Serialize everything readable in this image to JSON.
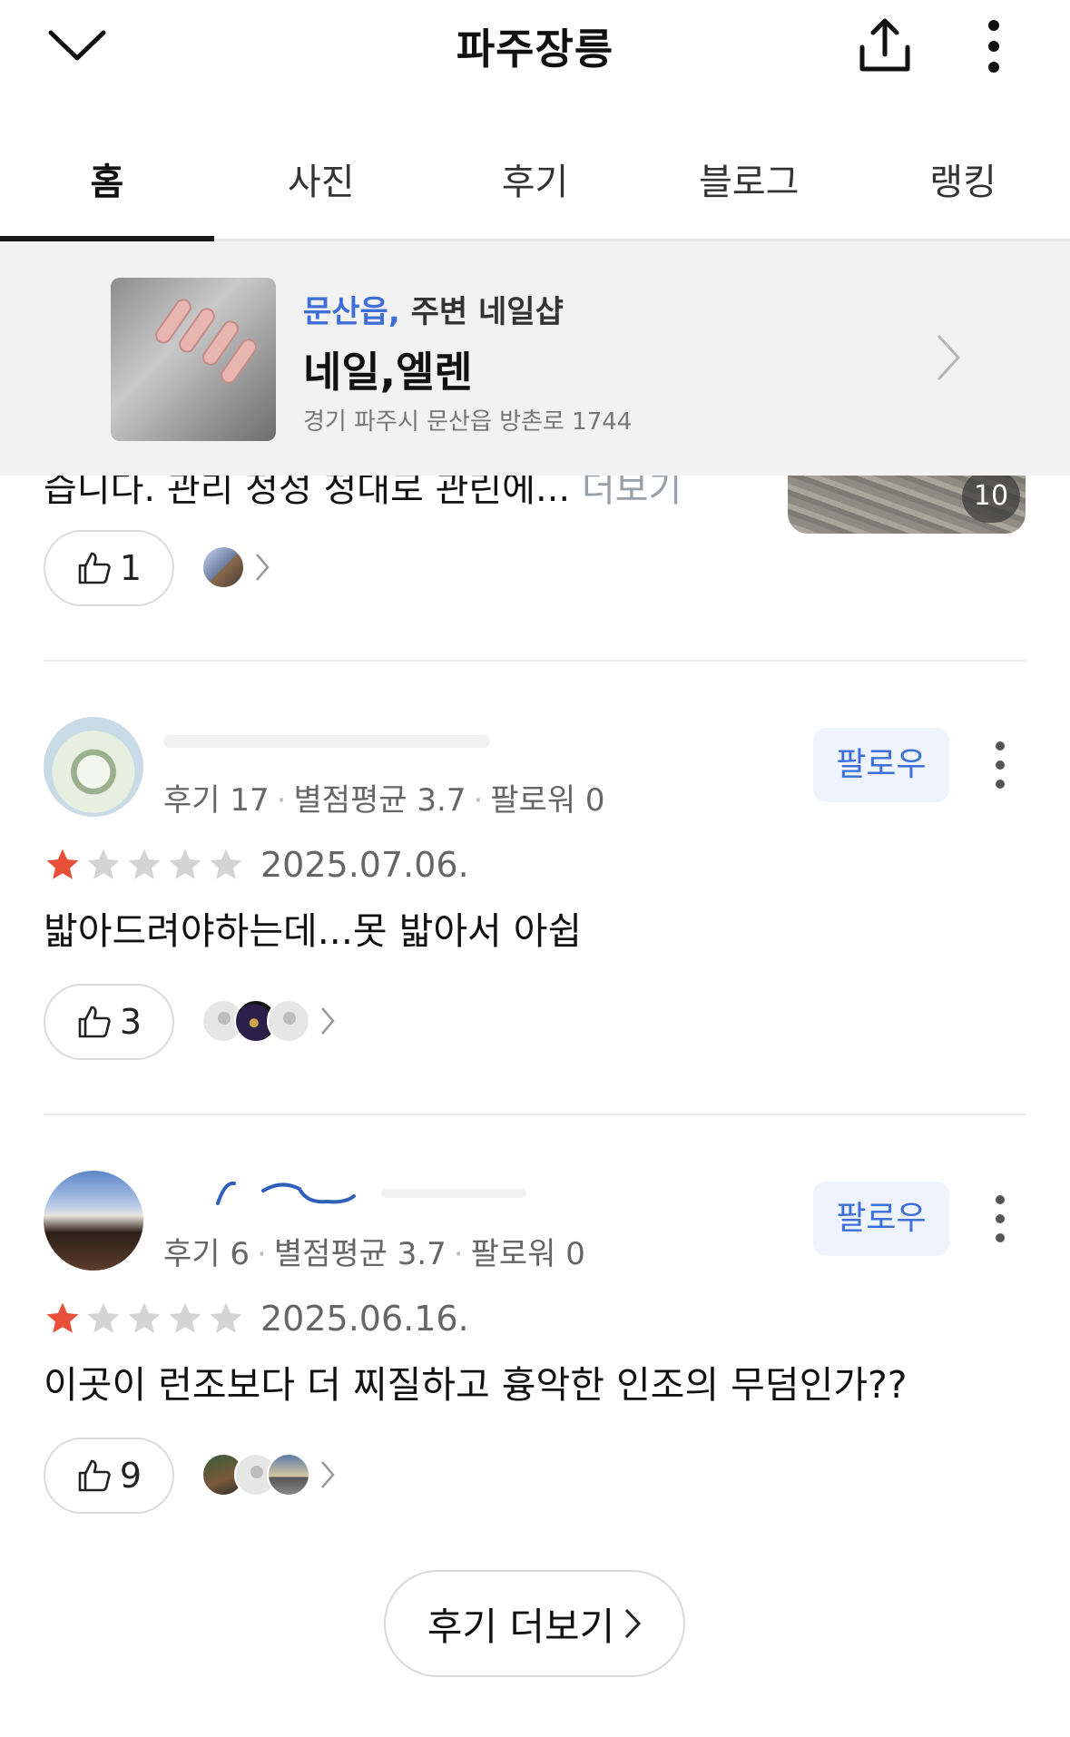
{
  "header": {
    "title": "파주장릉",
    "back_icon": "chevron-down-icon",
    "share_icon": "share-icon",
    "more_icon": "more-vertical-icon"
  },
  "tabs": [
    {
      "label": "홈",
      "active": true
    },
    {
      "label": "사진",
      "active": false
    },
    {
      "label": "후기",
      "active": false
    },
    {
      "label": "블로그",
      "active": false
    },
    {
      "label": "랭킹",
      "active": false
    }
  ],
  "banner": {
    "area": "문산읍,",
    "category": "주변 네일샵",
    "name": "네일,엘렌",
    "address": "경기 파주시 문산읍 방촌로 1744"
  },
  "partial_review": {
    "text_fragment": "습니다. 관리 정성 정대로 관린에...",
    "more_label": "더보기",
    "photo_count": "10",
    "likes": "1"
  },
  "reviews": [
    {
      "meta_reviews": "후기 17",
      "meta_rating": "별점평균 3.7",
      "meta_followers": "팔로워 0",
      "follow_label": "팔로우",
      "rating": 1,
      "date": "2025.07.06.",
      "text": "밟아드려야하는데...못 밟아서 아쉽",
      "likes": "3"
    },
    {
      "meta_reviews": "후기 6",
      "meta_rating": "별점평균 3.7",
      "meta_followers": "팔로워 0",
      "follow_label": "팔로우",
      "rating": 1,
      "date": "2025.06.16.",
      "text": "이곳이 런조보다 더 찌질하고 흉악한 인조의 무덤인가??",
      "likes": "9"
    }
  ],
  "more_reviews_label": "후기 더보기",
  "colors": {
    "accent_blue": "#3f6ed8",
    "star_filled": "#e8503a",
    "star_empty": "#d4d4d4",
    "follow_bg": "#eef3fd"
  }
}
